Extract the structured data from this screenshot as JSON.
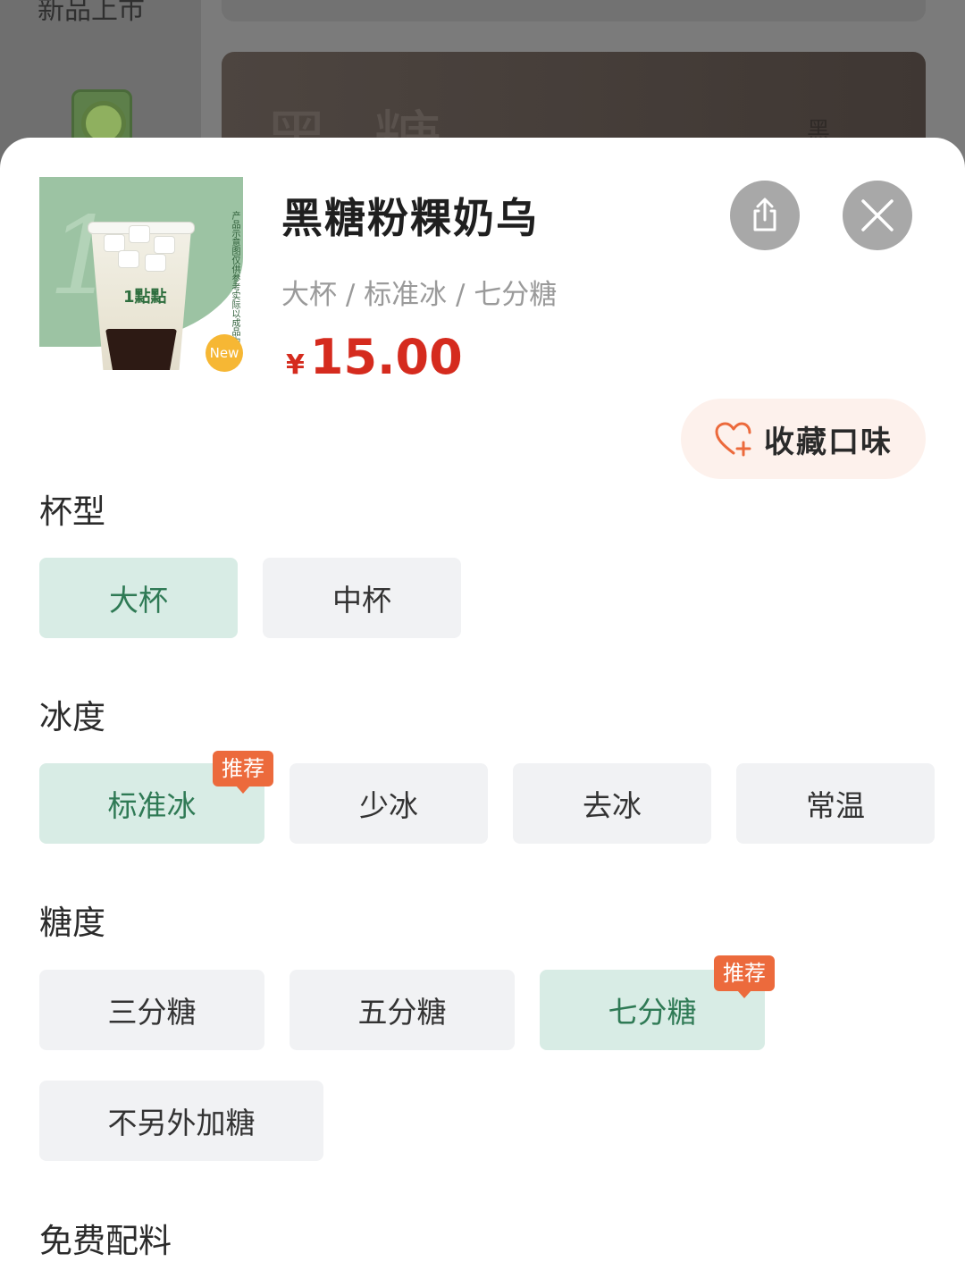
{
  "background": {
    "category_label": "新品上市",
    "banner_text": "黑 糖",
    "banner_small": "黑"
  },
  "product": {
    "name": "黑糖粉粿奶乌",
    "spec_summary": "大杯 / 标准冰 / 七分糖",
    "currency": "¥",
    "price": "15.00",
    "new_badge": "New",
    "image_note": "产品示意图仅供参考实际以成品为准",
    "cup_logo": "1點點"
  },
  "actions": {
    "share_icon": "share-icon",
    "close_icon": "close-icon",
    "favorite_label": "收藏口味",
    "favorite_icon": "heart-plus-icon"
  },
  "sections": {
    "cup_size": {
      "title": "杯型",
      "options": [
        {
          "label": "大杯",
          "selected": true
        },
        {
          "label": "中杯",
          "selected": false
        }
      ]
    },
    "ice": {
      "title": "冰度",
      "options": [
        {
          "label": "标准冰",
          "selected": true,
          "badge": "推荐"
        },
        {
          "label": "少冰",
          "selected": false
        },
        {
          "label": "去冰",
          "selected": false
        },
        {
          "label": "常温",
          "selected": false
        }
      ]
    },
    "sugar": {
      "title": "糖度",
      "options": [
        {
          "label": "三分糖",
          "selected": false
        },
        {
          "label": "五分糖",
          "selected": false
        },
        {
          "label": "七分糖",
          "selected": true,
          "badge": "推荐"
        },
        {
          "label": "不另外加糖",
          "selected": false
        }
      ]
    },
    "toppings": {
      "title": "免费配料"
    }
  },
  "colors": {
    "accent_price": "#d52b1e",
    "selected_bg": "#d8ece5",
    "selected_text": "#2f7a55",
    "badge": "#ec6a3c",
    "favorite_bg": "#fdf1ec",
    "favorite_icon": "#ec6a3c"
  }
}
